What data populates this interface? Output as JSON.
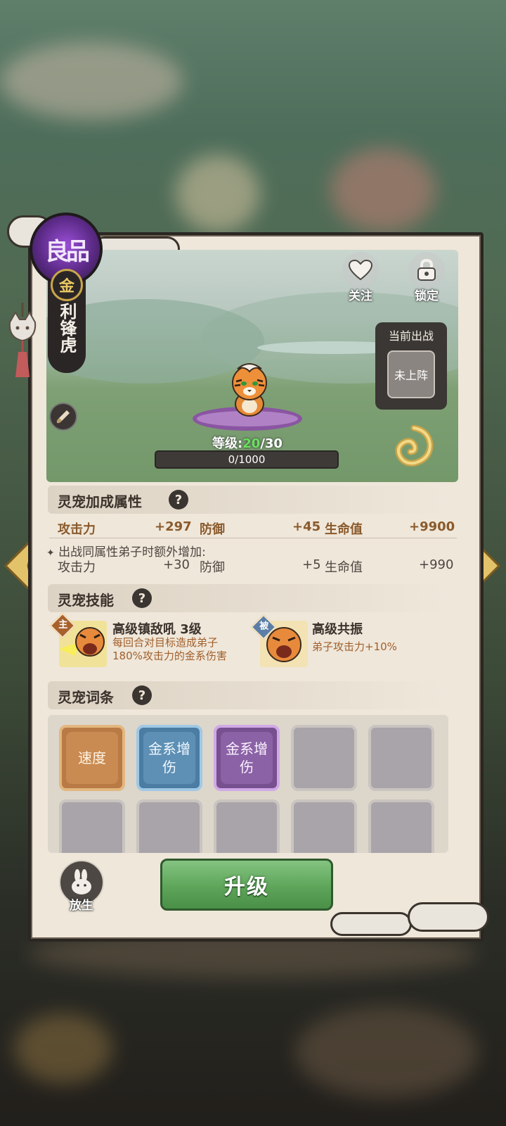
{
  "pet": {
    "quality": "良品",
    "element": "金",
    "name": "利锋虎",
    "level_label": "等级:",
    "level_current": "20",
    "level_max": "/30",
    "exp": "0/1000"
  },
  "actions": {
    "follow": "关注",
    "lock": "锁定",
    "release": "放生",
    "upgrade": "升级"
  },
  "deploy": {
    "title": "当前出战",
    "status": "未上阵"
  },
  "attributes": {
    "title": "灵宠加成属性",
    "help": "?",
    "rows": [
      {
        "label": "攻击力",
        "value": "+297"
      },
      {
        "label": "防御",
        "value": "+45"
      },
      {
        "label": "生命值",
        "value": "+9900"
      }
    ],
    "note": "出战同属性弟子时额外增加:",
    "bonus_rows": [
      {
        "label": "攻击力",
        "value": "+30"
      },
      {
        "label": "防御",
        "value": "+5"
      },
      {
        "label": "生命值",
        "value": "+990"
      }
    ]
  },
  "skills": {
    "title": "灵宠技能",
    "help": "?",
    "items": [
      {
        "tag": "主",
        "name": "高级镇敌吼 3级",
        "desc": "每回合对目标造成弟子180%攻击力的金系伤害"
      },
      {
        "tag": "被",
        "name": "高级共振",
        "desc": "弟子攻击力+10%"
      }
    ]
  },
  "entries": {
    "title": "灵宠词条",
    "help": "?",
    "slots": [
      {
        "text": "速度",
        "color": "#c98b52"
      },
      {
        "text": "金系增伤",
        "color": "#5e8fb4"
      },
      {
        "text": "金系增伤",
        "color": "#8b62a6"
      }
    ]
  },
  "colors": {
    "level_green": "#68e15f",
    "quality_purple": "#5b2a86",
    "stat_brown": "#8a5a2c"
  }
}
